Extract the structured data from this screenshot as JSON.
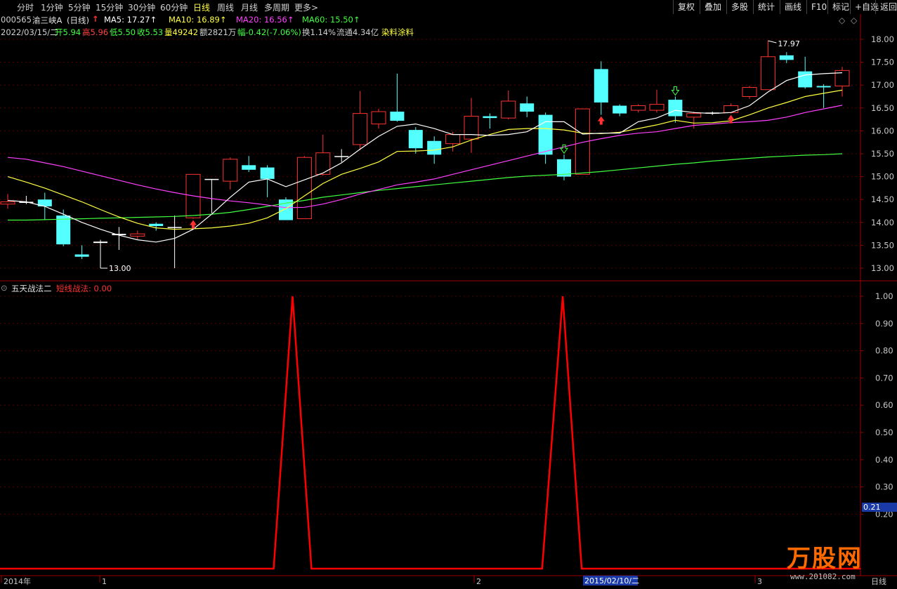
{
  "periods": [
    "分时",
    "1分钟",
    "5分钟",
    "15分钟",
    "30分钟",
    "60分钟",
    "日线",
    "周线",
    "月线",
    "多周期",
    "更多>"
  ],
  "active_period": "日线",
  "right_buttons": [
    "复权",
    "叠加",
    "多股",
    "统计",
    "画线",
    "F10",
    "标记",
    "+自选",
    "返回"
  ],
  "stock": {
    "code": "000565",
    "name": "渝三峡A",
    "period_tag": "(日线)",
    "ma_labels": [
      {
        "text": "MA5: 17.27↑",
        "color": "#ffffff"
      },
      {
        "text": "MA10: 16.89↑",
        "color": "#ffff40"
      },
      {
        "text": "MA20: 16.56↑",
        "color": "#ff40ff"
      },
      {
        "text": "MA60: 15.50↑",
        "color": "#40ff40"
      }
    ]
  },
  "info_line": {
    "date": "2022/03/15/二",
    "items": [
      {
        "text": "开5.94",
        "color": "#40ff40"
      },
      {
        "text": "高5.96",
        "color": "#ff4040"
      },
      {
        "text": "低5.50",
        "color": "#40ff40"
      },
      {
        "text": "收5.53",
        "color": "#40ff40"
      },
      {
        "text": "量49242",
        "color": "#ffff40"
      },
      {
        "text": "额2821万",
        "color": "#d0d0d0"
      },
      {
        "text": "幅-0.42(-7.06%)",
        "color": "#40ff40"
      },
      {
        "text": "换1.14%",
        "color": "#d0d0d0"
      },
      {
        "text": "流通4.34亿",
        "color": "#d0d0d0"
      },
      {
        "text": "染料涂料",
        "color": "#ffff40"
      }
    ]
  },
  "indicator": {
    "name": "五天战法二",
    "label": "短线战法: 0.00",
    "value_tag": "0.21"
  },
  "annotations": {
    "high": "17.97",
    "low": "13.00"
  },
  "x_axis": {
    "labels": [
      {
        "text": "2014年",
        "x": 2
      },
      {
        "text": "1",
        "x": 142
      },
      {
        "text": "2",
        "x": 675
      },
      {
        "text": "3",
        "x": 1075
      }
    ],
    "cursor_date": "2015/02/10/二",
    "period": "日线"
  },
  "watermark": {
    "brand": "万股网",
    "url": "www.201082.com"
  },
  "colors": {
    "up": "#ff3232",
    "down": "#54ffff",
    "ma5": "#ffffff",
    "ma10": "#ffff40",
    "ma20": "#ff40ff",
    "ma60": "#40ff40",
    "signal": "#ff0000",
    "grid": "#5a0000"
  },
  "chart_data": [
    {
      "type": "candlestick",
      "ylim": [
        12.8,
        18.2
      ],
      "yticks": [
        13.0,
        13.5,
        14.0,
        14.5,
        15.0,
        15.5,
        16.0,
        16.5,
        17.0,
        17.5,
        18.0
      ],
      "candles": [
        {
          "o": 14.4,
          "c": 14.45,
          "h": 14.62,
          "l": 14.3
        },
        {
          "o": 14.45,
          "c": 14.45,
          "h": 14.58,
          "l": 14.4
        },
        {
          "o": 14.5,
          "c": 14.35,
          "h": 14.65,
          "l": 14.05
        },
        {
          "o": 14.15,
          "c": 13.52,
          "h": 14.28,
          "l": 13.48
        },
        {
          "o": 13.3,
          "c": 13.25,
          "h": 13.5,
          "l": 13.2
        },
        {
          "o": 13.58,
          "c": 13.55,
          "h": 13.62,
          "l": 13.0
        },
        {
          "o": 13.75,
          "c": 13.72,
          "h": 13.9,
          "l": 13.4
        },
        {
          "o": 13.7,
          "c": 13.75,
          "h": 13.82,
          "l": 13.62
        },
        {
          "o": 13.97,
          "c": 13.92,
          "h": 14.0,
          "l": 13.82
        },
        {
          "o": 13.9,
          "c": 13.88,
          "h": 14.15,
          "l": 13.0
        },
        {
          "o": 14.1,
          "c": 15.05,
          "h": 15.05,
          "l": 14.08
        },
        {
          "o": 14.95,
          "c": 14.95,
          "h": 14.95,
          "l": 14.2
        },
        {
          "o": 14.9,
          "c": 15.38,
          "h": 15.42,
          "l": 14.72
        },
        {
          "o": 15.25,
          "c": 15.15,
          "h": 15.45,
          "l": 15.1
        },
        {
          "o": 15.2,
          "c": 14.95,
          "h": 15.25,
          "l": 14.55
        },
        {
          "o": 14.5,
          "c": 14.05,
          "h": 14.55,
          "l": 14.05
        },
        {
          "o": 14.08,
          "c": 15.42,
          "h": 15.45,
          "l": 14.08
        },
        {
          "o": 15.05,
          "c": 15.52,
          "h": 15.92,
          "l": 15.02
        },
        {
          "o": 15.45,
          "c": 15.45,
          "h": 15.6,
          "l": 15.32
        },
        {
          "o": 15.7,
          "c": 16.38,
          "h": 16.87,
          "l": 15.58
        },
        {
          "o": 16.15,
          "c": 16.42,
          "h": 16.48,
          "l": 16.05
        },
        {
          "o": 16.42,
          "c": 16.22,
          "h": 17.25,
          "l": 16.2
        },
        {
          "o": 16.02,
          "c": 15.62,
          "h": 16.08,
          "l": 15.5
        },
        {
          "o": 15.78,
          "c": 15.48,
          "h": 15.88,
          "l": 15.28
        },
        {
          "o": 15.72,
          "c": 15.92,
          "h": 15.98,
          "l": 15.55
        },
        {
          "o": 15.82,
          "c": 16.32,
          "h": 16.72,
          "l": 15.52
        },
        {
          "o": 16.32,
          "c": 16.28,
          "h": 16.38,
          "l": 16.05
        },
        {
          "o": 16.28,
          "c": 16.65,
          "h": 16.88,
          "l": 16.25
        },
        {
          "o": 16.6,
          "c": 16.42,
          "h": 16.75,
          "l": 16.3
        },
        {
          "o": 16.35,
          "c": 15.48,
          "h": 16.4,
          "l": 15.28
        },
        {
          "o": 15.38,
          "c": 15.0,
          "h": 15.48,
          "l": 14.92
        },
        {
          "o": 15.05,
          "c": 16.48,
          "h": 16.48,
          "l": 15.05
        },
        {
          "o": 17.35,
          "c": 16.62,
          "h": 17.52,
          "l": 16.35
        },
        {
          "o": 16.55,
          "c": 16.38,
          "h": 16.58,
          "l": 16.32
        },
        {
          "o": 16.45,
          "c": 16.55,
          "h": 16.58,
          "l": 16.4
        },
        {
          "o": 16.45,
          "c": 16.58,
          "h": 16.9,
          "l": 16.4
        },
        {
          "o": 16.68,
          "c": 16.32,
          "h": 16.75,
          "l": 16.18
        },
        {
          "o": 16.3,
          "c": 16.38,
          "h": 16.42,
          "l": 16.05
        },
        {
          "o": 16.4,
          "c": 16.38,
          "h": 16.42,
          "l": 16.35
        },
        {
          "o": 16.4,
          "c": 16.55,
          "h": 16.6,
          "l": 16.38
        },
        {
          "o": 16.75,
          "c": 16.95,
          "h": 16.98,
          "l": 16.7
        },
        {
          "o": 16.9,
          "c": 17.62,
          "h": 17.97,
          "l": 16.9
        },
        {
          "o": 17.65,
          "c": 17.55,
          "h": 17.72,
          "l": 17.48
        },
        {
          "o": 17.3,
          "c": 16.95,
          "h": 17.62,
          "l": 16.92
        },
        {
          "o": 16.98,
          "c": 16.95,
          "h": 17.02,
          "l": 16.5
        },
        {
          "o": 16.98,
          "c": 17.32,
          "h": 17.4,
          "l": 16.75
        }
      ],
      "ma5": [
        14.48,
        14.45,
        14.35,
        14.18,
        14.0,
        13.85,
        13.72,
        13.62,
        13.57,
        13.65,
        13.85,
        14.18,
        14.55,
        14.88,
        14.95,
        14.78,
        14.93,
        15.08,
        15.3,
        15.6,
        15.88,
        16.1,
        16.15,
        16.05,
        15.92,
        15.92,
        15.9,
        15.92,
        15.98,
        16.2,
        16.2,
        15.93,
        15.95,
        15.95,
        16.2,
        16.28,
        16.45,
        16.4,
        16.38,
        16.4,
        16.55,
        16.85,
        17.1,
        17.22,
        17.25,
        17.27
      ],
      "ma10": [
        15.0,
        14.88,
        14.75,
        14.6,
        14.45,
        14.28,
        14.12,
        13.98,
        13.88,
        13.85,
        13.86,
        13.88,
        13.92,
        13.98,
        14.1,
        14.3,
        14.58,
        14.85,
        15.05,
        15.18,
        15.32,
        15.55,
        15.56,
        15.58,
        15.65,
        15.8,
        15.92,
        16.03,
        16.05,
        16.05,
        16.02,
        15.95,
        15.94,
        15.97,
        16.05,
        16.13,
        16.23,
        16.17,
        16.18,
        16.22,
        16.35,
        16.5,
        16.62,
        16.75,
        16.82,
        16.89
      ],
      "ma20": [
        15.42,
        15.38,
        15.3,
        15.22,
        15.12,
        15.02,
        14.92,
        14.82,
        14.73,
        14.65,
        14.58,
        14.52,
        14.47,
        14.43,
        14.38,
        14.32,
        14.33,
        14.4,
        14.5,
        14.62,
        14.72,
        14.82,
        14.88,
        14.95,
        15.05,
        15.15,
        15.25,
        15.35,
        15.45,
        15.55,
        15.65,
        15.75,
        15.83,
        15.9,
        15.95,
        15.98,
        16.05,
        16.12,
        16.15,
        16.18,
        16.2,
        16.23,
        16.3,
        16.4,
        16.48,
        16.56
      ],
      "ma60": [
        14.05,
        14.05,
        14.06,
        14.07,
        14.08,
        14.09,
        14.1,
        14.11,
        14.12,
        14.13,
        14.15,
        14.18,
        14.22,
        14.28,
        14.35,
        14.42,
        14.48,
        14.55,
        14.6,
        14.65,
        14.7,
        14.74,
        14.78,
        14.82,
        14.86,
        14.9,
        14.94,
        14.98,
        15.01,
        15.03,
        15.05,
        15.08,
        15.11,
        15.15,
        15.19,
        15.23,
        15.27,
        15.3,
        15.34,
        15.37,
        15.4,
        15.43,
        15.45,
        15.47,
        15.48,
        15.5
      ],
      "buy_marks": [
        10,
        32,
        39
      ],
      "sell_marks": [
        30,
        36
      ]
    },
    {
      "type": "line",
      "name": "短线战法",
      "ylim": [
        0,
        1.05
      ],
      "yticks": [
        0.2,
        0.3,
        0.4,
        0.5,
        0.6,
        0.7,
        0.8,
        0.9,
        1.0
      ],
      "x": [
        0,
        0.318,
        0.34,
        0.362,
        0.63,
        0.654,
        0.676,
        1
      ],
      "values": [
        0,
        0,
        1,
        0,
        0,
        1,
        0,
        0
      ]
    }
  ]
}
